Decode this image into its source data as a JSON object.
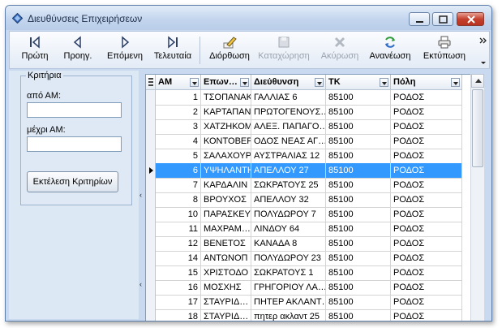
{
  "window": {
    "title": "Διευθύνσεις Επιχειρήσεων"
  },
  "toolbar": {
    "first": "Πρώτη",
    "prev": "Προηγ.",
    "next": "Επόμενη",
    "last": "Τελευταία",
    "edit": "Διόρθωση",
    "save": "Καταχώρηση",
    "cancel": "Ακύρωση",
    "refresh": "Ανανέωση",
    "print": "Εκτύπωση"
  },
  "criteria": {
    "legend": "Κριτήρια",
    "from_label": "από ΑΜ:",
    "from_value": "",
    "to_label": "μέχρι ΑΜ:",
    "to_value": "",
    "run_button": "Εκτέλεση Κριτηρίων"
  },
  "grid": {
    "columns": [
      "ΑΜ",
      "Επων…",
      "Διεύθυνση",
      "ΤΚ",
      "Πόλη"
    ],
    "selected_row": 5,
    "rows": [
      [
        "1",
        "ΤΣΟΠΑΝΑΚ",
        "ΓΑΛΛΙΑΣ 6",
        "85100",
        "ΡΟΔΟΣ"
      ],
      [
        "2",
        "ΚΑΡΤΑΠΑΝ",
        "ΠΡΩΤΟΓΕΝΟΥΣ…",
        "85100",
        "ΡΟΔΟΣ"
      ],
      [
        "3",
        "ΧΑΤΖΗΚΟΜ",
        "ΑΛΕΞ. ΠΑΠΑΓΟ…",
        "85100",
        "ΡΟΔΟΣ"
      ],
      [
        "4",
        "ΚΟΝΤΟΒΕΡ",
        "ΟΔΟΣ ΝΕΑΣ ΑΓ…",
        "85100",
        "ΡΟΔΟΣ"
      ],
      [
        "5",
        "ΣΑΛΑΧΟΥΡ",
        "ΑΥΣΤΡΑΛΙΑΣ 12",
        "85100",
        "ΡΟΔΟΣ"
      ],
      [
        "6",
        "ΥΨΗΛΑΝΤΗ",
        "ΑΠΕΛΛΟΥ 27",
        "85100",
        "ΡΟΔΟΣ"
      ],
      [
        "7",
        "ΚΑΡΔΑΛΙΝ",
        "ΣΩΚΡΑΤΟΥΣ 25",
        "85100",
        "ΡΟΔΟΣ"
      ],
      [
        "8",
        "ΒΡΟΥΧΟΣ",
        "ΑΠΕΛΛΟΥ 32",
        "85100",
        "ΡΟΔΟΣ"
      ],
      [
        "10",
        "ΠΑΡΑΣΚΕΥ",
        "ΠΟΛΥΔΩΡΟΥ 7",
        "85100",
        "ΡΟΔΟΣ"
      ],
      [
        "11",
        "ΜΑΧΡΑΜ…",
        "ΛΙΝΔΟΥ 64",
        "85100",
        "ΡΟΔΟΣ"
      ],
      [
        "12",
        "ΒΕΝΕΤΟΣ",
        "ΚΑΝΑΔΑ 8",
        "85100",
        "ΡΟΔΟΣ"
      ],
      [
        "14",
        "ΑΝΤΩΝΟΠ",
        "ΠΟΛΥΔΩΡΟΥ 23",
        "85100",
        "ΡΟΔΟΣ"
      ],
      [
        "15",
        "ΧΡΙΣΤΟΔΟ",
        "ΣΩΚΡΑΤΟΥΣ 1",
        "85100",
        "ΡΟΔΟΣ"
      ],
      [
        "16",
        "ΜΟΣΧΗΣ",
        "ΓΡΗΓΟΡΙΟΥ ΛΑ…",
        "85100",
        "ΡΟΔΟΣ"
      ],
      [
        "17",
        "ΣΤΑΥΡΙΔ…",
        "ΠΗΤΕΡ ΑΚΛΑΝΤ…",
        "85100",
        "ΡΟΔΟΣ"
      ],
      [
        "18",
        "ΣΤΑΥΡΙΔ…",
        "πητερ ακλαντ 25",
        "85100",
        "ΡΟΔΟΣ"
      ]
    ]
  },
  "colors": {
    "selection": "#3399ff",
    "chrome": "#c9daf0"
  }
}
